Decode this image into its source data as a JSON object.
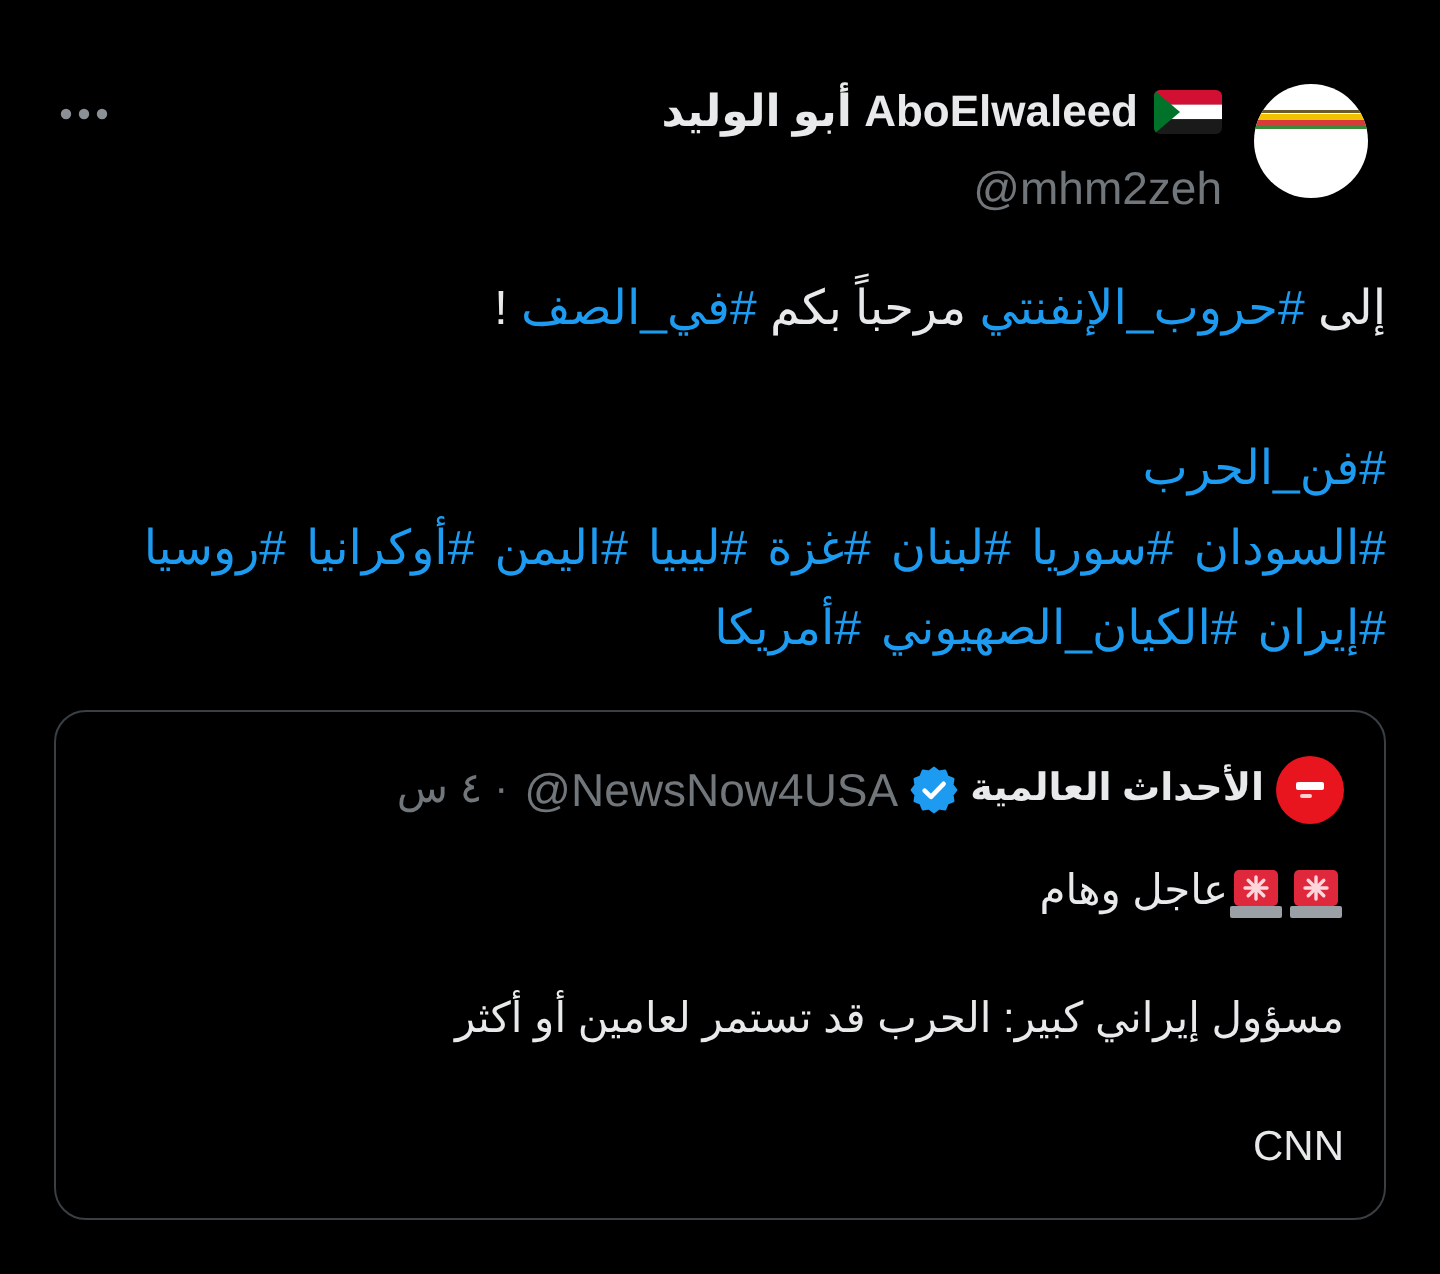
{
  "post": {
    "author": {
      "display_name": "AboElwaleed أبو الوليد",
      "handle": "@mhm2zeh"
    },
    "paragraphs": [
      {
        "lines": [
          [
            {
              "kind": "text",
              "text": "إلى "
            },
            {
              "kind": "hashtag",
              "text": "#حروب_الإنفنتي"
            },
            {
              "kind": "text",
              "text": " مرحباً بكم "
            },
            {
              "kind": "hashtag",
              "text": "#في_الصف"
            },
            {
              "kind": "text",
              "text": " !"
            }
          ]
        ]
      },
      {
        "lines": [
          [
            {
              "kind": "hashtag",
              "text": "#فن_الحرب"
            }
          ],
          [
            {
              "kind": "hashtag",
              "text": "#السودان"
            },
            {
              "kind": "hashtag",
              "text": "#سوريا"
            },
            {
              "kind": "hashtag",
              "text": "#لبنان"
            },
            {
              "kind": "hashtag",
              "text": "#غزة"
            },
            {
              "kind": "hashtag",
              "text": "#ليبيا"
            },
            {
              "kind": "hashtag",
              "text": "#اليمن"
            },
            {
              "kind": "hashtag",
              "text": "#أوكرانيا"
            },
            {
              "kind": "hashtag",
              "text": "#روسيا"
            }
          ],
          [
            {
              "kind": "hashtag",
              "text": "#إيران"
            },
            {
              "kind": "hashtag",
              "text": "#الكيان_الصهيوني"
            },
            {
              "kind": "hashtag",
              "text": "#أمريكا"
            }
          ]
        ]
      }
    ]
  },
  "quoted_post": {
    "author": {
      "display_name": "الأحداث العالمية",
      "verified": true,
      "handle": "@NewsNow4USA"
    },
    "separator": "·",
    "time": "٤ س",
    "paragraphs": [
      {
        "kind": "alert",
        "text": "عاجل وهام"
      },
      {
        "kind": "plain",
        "text": "مسؤول إيراني كبير: الحرب قد تستمر لعامين أو أكثر"
      },
      {
        "kind": "plain",
        "text": "CNN"
      }
    ]
  }
}
